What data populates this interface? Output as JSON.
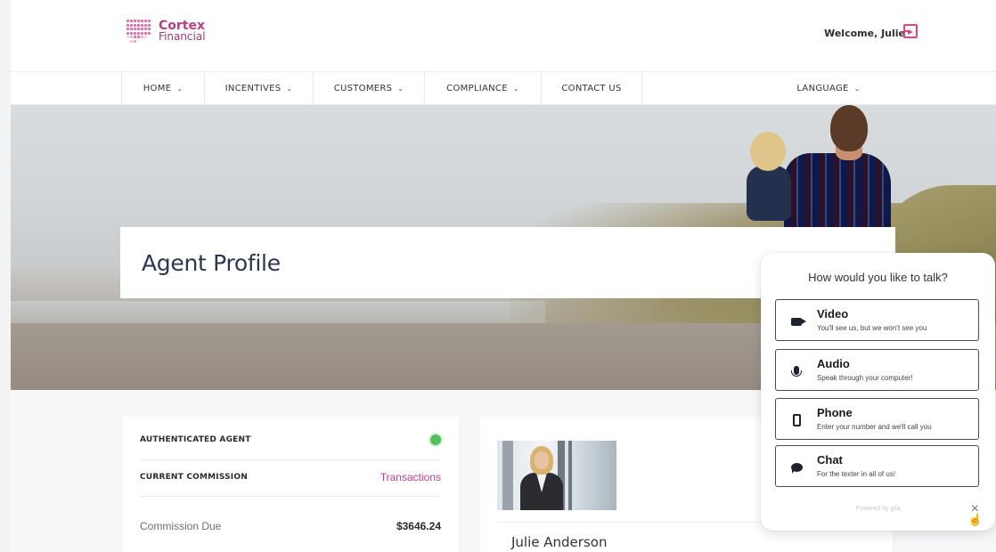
{
  "header": {
    "logo_line1": "Cortex",
    "logo_line2": "Financial",
    "welcome": "Welcome, Julie"
  },
  "nav": {
    "items": [
      {
        "label": "HOME",
        "has_dropdown": true
      },
      {
        "label": "INCENTIVES",
        "has_dropdown": true
      },
      {
        "label": "CUSTOMERS",
        "has_dropdown": true
      },
      {
        "label": "COMPLIANCE",
        "has_dropdown": true
      },
      {
        "label": "CONTACT US",
        "has_dropdown": false
      }
    ],
    "language": "LANGUAGE"
  },
  "hero": {
    "title": "Agent Profile"
  },
  "left_card": {
    "authenticated_label": "AUTHENTICATED AGENT",
    "authenticated_status_color": "#52c05a",
    "commission_label": "CURRENT COMMISSION",
    "transactions_link": "Transactions",
    "commission_due_label": "Commission Due",
    "commission_due_value": "$3646.24"
  },
  "right_card": {
    "agent_name": "Julie Anderson"
  },
  "widget": {
    "title": "How would you like to talk?",
    "options": [
      {
        "icon": "video-camera-icon",
        "label": "Video",
        "sub": "You'll see us, but we won't see you"
      },
      {
        "icon": "microphone-icon",
        "label": "Audio",
        "sub": "Speak through your computer!"
      },
      {
        "icon": "mobile-phone-icon",
        "label": "Phone",
        "sub": "Enter your number and we'll call you"
      },
      {
        "icon": "chat-bubble-icon",
        "label": "Chat",
        "sub": "For the texter in all of us!"
      }
    ],
    "powered_by": "Powered by glia",
    "close": "×"
  },
  "colors": {
    "brand_pink": "#b93f83",
    "link_pink": "#c04088",
    "title_navy": "#2c3650"
  }
}
